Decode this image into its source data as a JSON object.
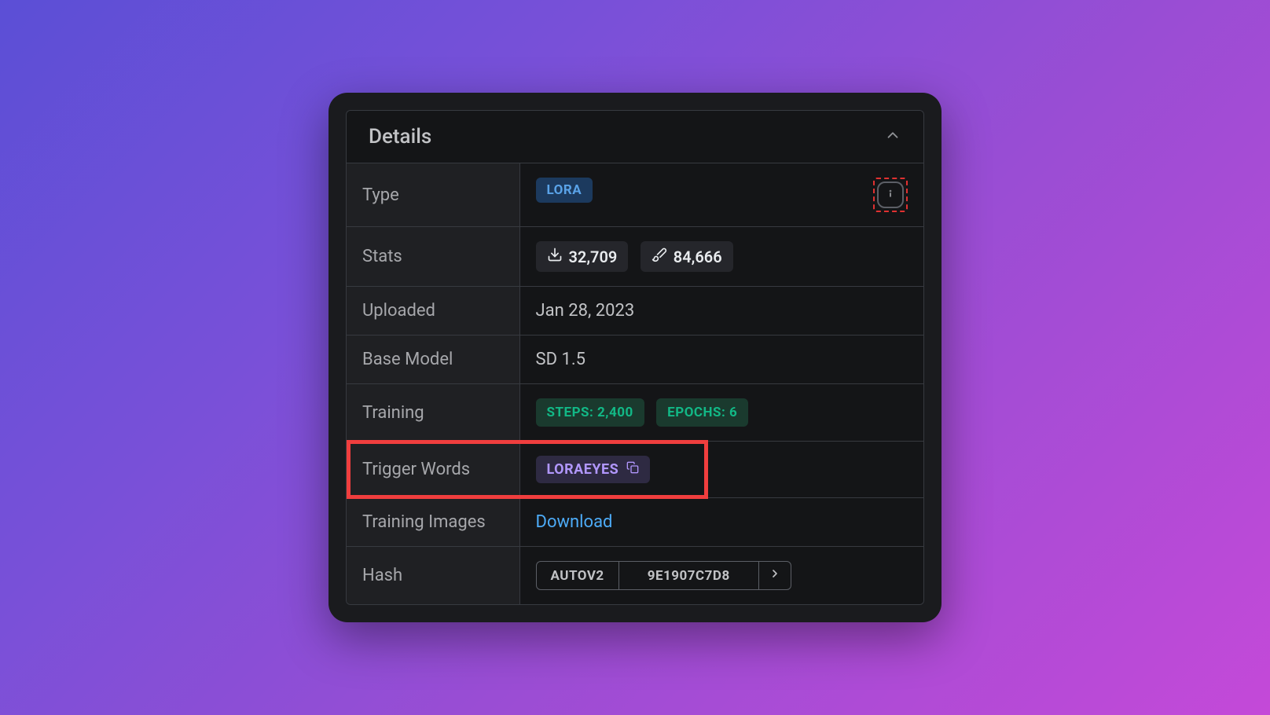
{
  "header": {
    "title": "Details"
  },
  "rows": {
    "type": {
      "label": "Type",
      "badge": "LORA"
    },
    "stats": {
      "label": "Stats",
      "downloads": "32,709",
      "uses": "84,666"
    },
    "uploaded": {
      "label": "Uploaded",
      "value": "Jan 28, 2023"
    },
    "baseModel": {
      "label": "Base Model",
      "value": "SD 1.5"
    },
    "training": {
      "label": "Training",
      "steps": "STEPS: 2,400",
      "epochs": "EPOCHS: 6"
    },
    "triggerWords": {
      "label": "Trigger Words",
      "word": "LORAEYES"
    },
    "trainingImages": {
      "label": "Training Images",
      "link": "Download"
    },
    "hash": {
      "label": "Hash",
      "type": "AUTOV2",
      "value": "9E1907C7D8"
    }
  }
}
